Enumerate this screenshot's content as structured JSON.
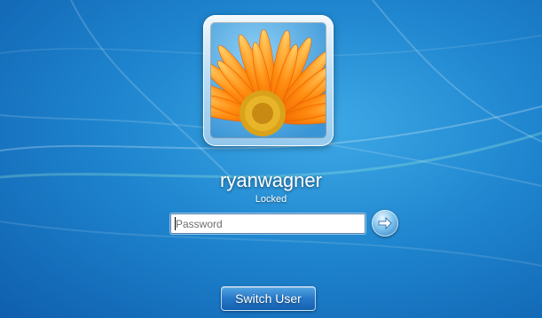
{
  "user": {
    "name": "ryanwagner",
    "status": "Locked",
    "avatar_icon": "flower-avatar"
  },
  "login": {
    "password_placeholder": "Password",
    "password_value": "",
    "submit_icon": "arrow-right-icon"
  },
  "footer": {
    "switch_user_label": "Switch User"
  },
  "colors": {
    "background": "#1f86cf",
    "text": "#ffffff"
  }
}
